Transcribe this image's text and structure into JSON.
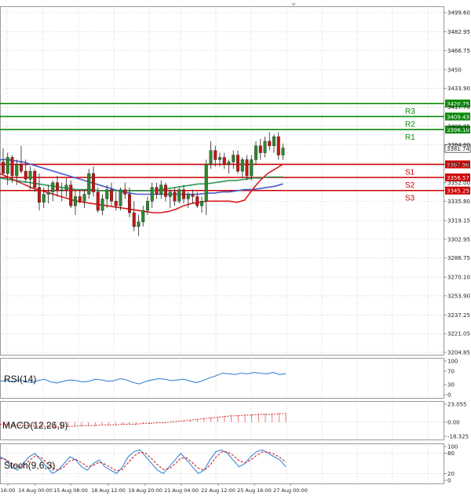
{
  "chart_data": {
    "type": "candlestick",
    "main": {
      "price_ticks": [
        "3499.60",
        "3482.95",
        "3466.75",
        "3450",
        "3433.90",
        "3417.70",
        "3400.95",
        "3384.80",
        "3368.05",
        "3352.00",
        "3335.80",
        "3319.15",
        "3302.95",
        "3286.75",
        "3270.10",
        "3253.90",
        "3237.25",
        "3221.05",
        "3204.85"
      ],
      "ylim": [
        3204.85,
        3499.6
      ],
      "levels": [
        {
          "name": "R3",
          "value": 3420.75,
          "label": "3420.75",
          "color": "#0a8a0a"
        },
        {
          "name": "R2",
          "value": 3409.43,
          "label": "3409.43",
          "color": "#0a8a0a"
        },
        {
          "name": "R1",
          "value": 3398.1,
          "label": "3398.10",
          "color": "#0a8a0a"
        },
        {
          "name": "S1",
          "value": 3367.9,
          "label": "3367.90",
          "color": "#cc0000"
        },
        {
          "name": "S2",
          "value": 3356.57,
          "label": "3356.57",
          "color": "#cc0000"
        },
        {
          "name": "S3",
          "value": 3345.25,
          "label": "3345.25",
          "color": "#cc0000"
        }
      ],
      "last_price": "3381.74",
      "candles": [
        [
          3370,
          3382,
          3362,
          3360
        ],
        [
          3360,
          3378,
          3350,
          3374
        ],
        [
          3374,
          3376,
          3352,
          3358
        ],
        [
          3358,
          3372,
          3350,
          3368
        ],
        [
          3368,
          3384,
          3360,
          3362
        ],
        [
          3362,
          3372,
          3352,
          3355
        ],
        [
          3355,
          3366,
          3346,
          3362
        ],
        [
          3362,
          3364,
          3344,
          3348
        ],
        [
          3348,
          3360,
          3328,
          3335
        ],
        [
          3335,
          3348,
          3330,
          3342
        ],
        [
          3342,
          3350,
          3334,
          3344
        ],
        [
          3344,
          3354,
          3336,
          3352
        ],
        [
          3352,
          3358,
          3340,
          3345
        ],
        [
          3345,
          3352,
          3336,
          3346
        ],
        [
          3346,
          3356,
          3340,
          3350
        ],
        [
          3350,
          3354,
          3330,
          3332
        ],
        [
          3332,
          3345,
          3324,
          3340
        ],
        [
          3340,
          3346,
          3334,
          3336
        ],
        [
          3336,
          3346,
          3330,
          3342
        ],
        [
          3342,
          3364,
          3338,
          3360
        ],
        [
          3360,
          3366,
          3340,
          3344
        ],
        [
          3344,
          3348,
          3326,
          3328
        ],
        [
          3328,
          3342,
          3324,
          3338
        ],
        [
          3338,
          3350,
          3330,
          3346
        ],
        [
          3346,
          3352,
          3332,
          3336
        ],
        [
          3336,
          3344,
          3328,
          3332
        ],
        [
          3332,
          3348,
          3328,
          3346
        ],
        [
          3346,
          3352,
          3338,
          3342
        ],
        [
          3342,
          3348,
          3322,
          3326
        ],
        [
          3326,
          3336,
          3310,
          3314
        ],
        [
          3314,
          3324,
          3306,
          3318
        ],
        [
          3318,
          3332,
          3314,
          3328
        ],
        [
          3328,
          3340,
          3324,
          3336
        ],
        [
          3336,
          3352,
          3330,
          3348
        ],
        [
          3348,
          3352,
          3338,
          3342
        ],
        [
          3342,
          3354,
          3338,
          3350
        ],
        [
          3350,
          3352,
          3336,
          3340
        ],
        [
          3340,
          3346,
          3330,
          3344
        ],
        [
          3344,
          3348,
          3332,
          3336
        ],
        [
          3336,
          3348,
          3334,
          3346
        ],
        [
          3346,
          3350,
          3334,
          3338
        ],
        [
          3338,
          3344,
          3330,
          3342
        ],
        [
          3342,
          3346,
          3334,
          3340
        ],
        [
          3340,
          3344,
          3330,
          3332
        ],
        [
          3332,
          3340,
          3326,
          3336
        ],
        [
          3336,
          3372,
          3324,
          3368
        ],
        [
          3368,
          3388,
          3364,
          3380
        ],
        [
          3380,
          3384,
          3366,
          3372
        ],
        [
          3372,
          3378,
          3366,
          3374
        ],
        [
          3374,
          3378,
          3364,
          3368
        ],
        [
          3368,
          3372,
          3360,
          3370
        ],
        [
          3370,
          3380,
          3364,
          3376
        ],
        [
          3376,
          3380,
          3360,
          3362
        ],
        [
          3362,
          3374,
          3356,
          3372
        ],
        [
          3372,
          3376,
          3354,
          3358
        ],
        [
          3358,
          3376,
          3354,
          3372
        ],
        [
          3372,
          3388,
          3368,
          3384
        ],
        [
          3384,
          3390,
          3372,
          3378
        ],
        [
          3378,
          3392,
          3374,
          3388
        ],
        [
          3388,
          3396,
          3380,
          3384
        ],
        [
          3384,
          3394,
          3378,
          3392
        ],
        [
          3392,
          3396,
          3372,
          3376
        ],
        [
          3376,
          3386,
          3372,
          3382
        ]
      ],
      "ma_red": [
        3360,
        3357,
        3354,
        3351,
        3348,
        3346,
        3344,
        3342,
        3340,
        3338,
        3336,
        3335,
        3334,
        3333,
        3332,
        3331,
        3330,
        3329,
        3328,
        3327,
        3326,
        3326,
        3327,
        3329,
        3332,
        3334,
        3335,
        3336,
        3336,
        3336,
        3336,
        3335,
        3337,
        3346,
        3354,
        3360,
        3364,
        3368
      ],
      "ma_green": [
        3356,
        3355,
        3354,
        3353,
        3352,
        3351,
        3350,
        3349,
        3348,
        3347,
        3346,
        3346,
        3346,
        3345,
        3345,
        3345,
        3345,
        3345,
        3345,
        3345,
        3345,
        3346,
        3347,
        3348,
        3349,
        3350,
        3351,
        3351,
        3352,
        3353,
        3354,
        3354,
        3355,
        3356,
        3356,
        3357,
        3357,
        3357
      ],
      "ma_blue": [
        3372,
        3372,
        3371,
        3370,
        3368,
        3366,
        3364,
        3362,
        3360,
        3358,
        3356,
        3354,
        3352,
        3350,
        3348,
        3346,
        3344,
        3343,
        3342,
        3342,
        3342,
        3342,
        3342,
        3342,
        3342,
        3342,
        3342,
        3343,
        3343,
        3344,
        3344,
        3345,
        3346,
        3346,
        3347,
        3348,
        3349,
        3351
      ]
    },
    "rsi": {
      "label": "RSI(14)",
      "ticks": [
        "100",
        "70",
        "30",
        "0"
      ],
      "values": [
        40,
        42,
        38,
        44,
        40,
        36,
        42,
        46,
        38,
        35,
        40,
        44,
        42,
        38,
        40,
        46,
        44,
        40,
        42,
        48,
        44,
        36,
        32,
        40,
        44,
        48,
        46,
        42,
        44,
        46,
        40,
        36,
        42,
        50,
        56,
        64,
        62,
        60,
        64,
        62,
        66,
        64,
        62,
        66,
        60,
        62
      ]
    },
    "macd": {
      "label": "MACD(12,26,9)",
      "ticks": [
        "23.055",
        "0.00",
        "-18.325"
      ],
      "values": [
        -3,
        -4,
        -4,
        -5,
        -5,
        -6,
        -6,
        -6,
        -7,
        -7,
        -6,
        -6,
        -5,
        -5,
        -5,
        -4,
        -4,
        -4,
        -3,
        -3,
        -3,
        -2,
        -2,
        -1,
        -1,
        0,
        1,
        2,
        3,
        4,
        5,
        6,
        7,
        8,
        9,
        9,
        10,
        10,
        11,
        11,
        11,
        12,
        12
      ]
    },
    "stoch": {
      "label": "Stoch(9,6,3)",
      "ticks": [
        "100",
        "80",
        "20",
        "0"
      ],
      "k": [
        70,
        60,
        40,
        30,
        50,
        70,
        80,
        60,
        40,
        20,
        30,
        50,
        70,
        60,
        40,
        30,
        50,
        60,
        40,
        30,
        20,
        40,
        70,
        85,
        90,
        70,
        50,
        30,
        20,
        40,
        60,
        80,
        60,
        40,
        20,
        30,
        60,
        85,
        90,
        80,
        60,
        40,
        50,
        70,
        85,
        90,
        80,
        70,
        60,
        40
      ],
      "d": [
        65,
        62,
        50,
        40,
        42,
        58,
        72,
        68,
        52,
        36,
        30,
        40,
        58,
        62,
        52,
        40,
        44,
        54,
        48,
        38,
        28,
        32,
        52,
        72,
        84,
        80,
        64,
        46,
        32,
        34,
        48,
        66,
        66,
        52,
        36,
        30,
        44,
        68,
        84,
        85,
        74,
        58,
        52,
        60,
        74,
        84,
        84,
        78,
        68,
        54
      ]
    },
    "x_labels": [
      "16:00",
      "14 Aug 00:00",
      "15 Aug 08:00",
      "18 Aug 12:00",
      "19 Aug 20:00",
      "21 Aug 04:00",
      "22 Aug 12:00",
      "25 Aug 16:00",
      "27 Aug 00:00"
    ]
  }
}
